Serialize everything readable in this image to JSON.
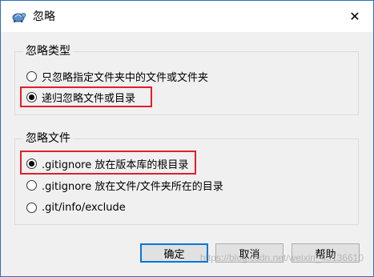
{
  "window": {
    "title": "忽略",
    "close_glyph": "✕"
  },
  "ignore_type": {
    "title": "忽略类型",
    "options": [
      {
        "label": "只忽略指定文件夹中的文件或文件夹",
        "checked": false
      },
      {
        "label": "递归忽略文件或目录",
        "checked": true
      }
    ]
  },
  "ignore_file": {
    "title": "忽略文件",
    "options": [
      {
        "label": ".gitignore 放在版本库的根目录",
        "checked": true
      },
      {
        "label": ".gitignore 放在文件/文件夹所在的目录",
        "checked": false
      },
      {
        "label": ".git/info/exclude",
        "checked": false
      }
    ]
  },
  "buttons": {
    "ok": "确定",
    "cancel": "取消",
    "help": "帮助"
  },
  "watermark": "https://blog.csdn.net/weixin_45136610",
  "colors": {
    "highlight": "#e0202a",
    "window_border": "#2f6fbf",
    "default_button_border": "#0078d7"
  }
}
